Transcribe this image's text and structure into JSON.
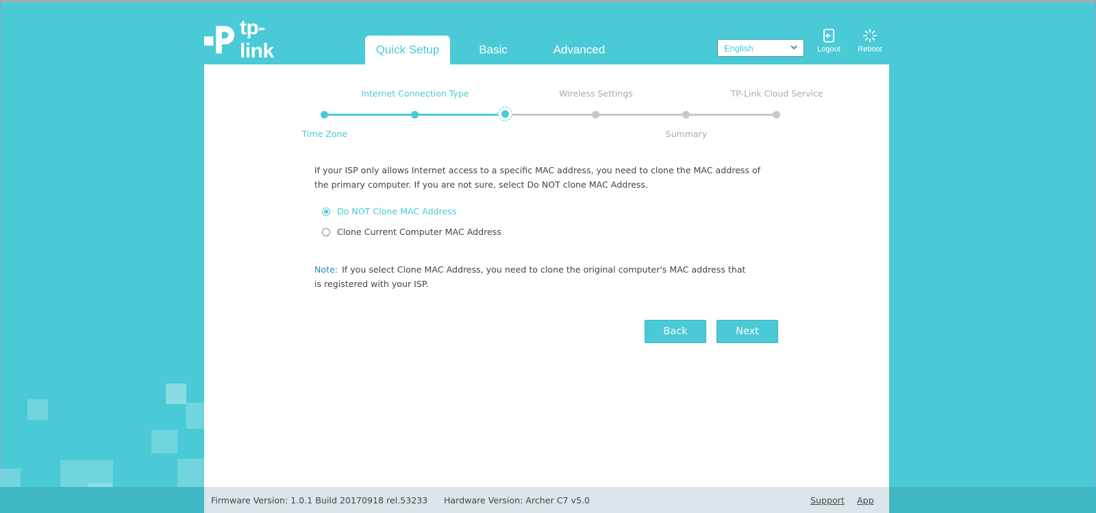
{
  "header": {
    "logo_text": "tp-link",
    "tabs": [
      {
        "label": "Quick Setup",
        "active": true
      },
      {
        "label": "Basic",
        "active": false
      },
      {
        "label": "Advanced",
        "active": false
      }
    ],
    "language": "English",
    "logout_label": "Logout",
    "reboot_label": "Reboot"
  },
  "stepper": {
    "steps": [
      {
        "label": "Time Zone",
        "state": "done"
      },
      {
        "label": "Internet Connection Type",
        "state": "done"
      },
      {
        "label": "",
        "state": "current"
      },
      {
        "label": "Wireless Settings",
        "state": "todo"
      },
      {
        "label": "Summary",
        "state": "todo"
      },
      {
        "label": "TP-Link Cloud Service",
        "state": "todo"
      }
    ]
  },
  "content": {
    "description": "If your ISP only allows Internet access to a specific MAC address, you need to clone the MAC address of the primary computer. If you are not sure, select Do NOT clone MAC Address.",
    "options": [
      {
        "label": "Do NOT Clone MAC Address",
        "selected": true
      },
      {
        "label": "Clone Current Computer MAC Address",
        "selected": false
      }
    ],
    "note_label": "Note:",
    "note_text": "If you select Clone MAC Address, you need to clone the original computer's MAC address that is registered with your ISP.",
    "back_label": "Back",
    "next_label": "Next"
  },
  "footer": {
    "firmware": "Firmware Version: 1.0.1 Build 20170918 rel.53233",
    "hardware": "Hardware Version: Archer C7 v5.0",
    "support_label": "Support",
    "app_label": "App"
  },
  "colors": {
    "accent": "#4acad6",
    "inactive": "#c8c8c8",
    "note": "#1a8fb5"
  }
}
